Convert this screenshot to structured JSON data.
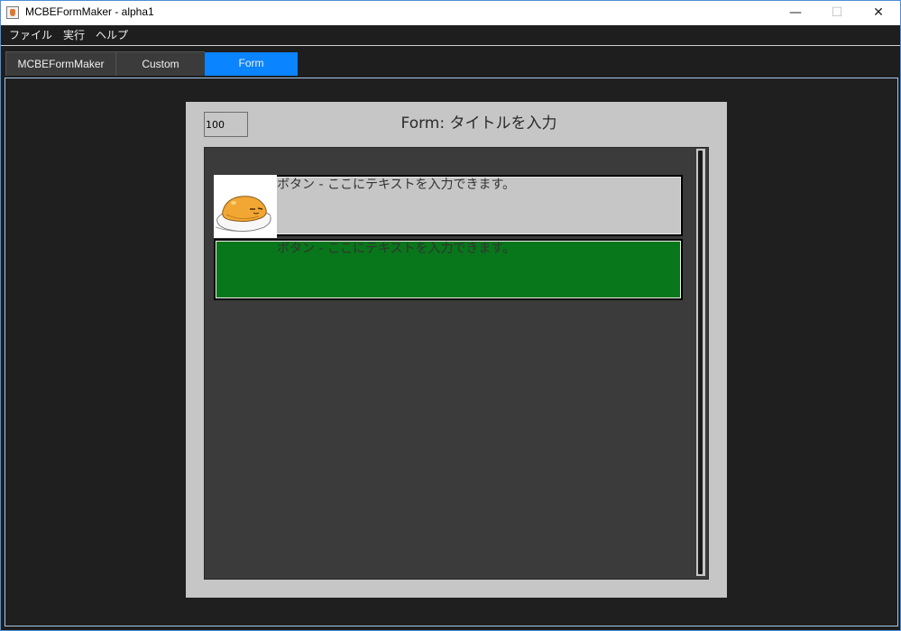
{
  "window": {
    "title": "MCBEFormMaker - alpha1",
    "controls": {
      "minimize": "—",
      "maximize": "☐",
      "close": "✕"
    }
  },
  "menu": [
    "ファイル",
    "実行",
    "ヘルプ"
  ],
  "tabs": [
    {
      "label": "MCBEFormMaker",
      "selected": false
    },
    {
      "label": "Custom",
      "selected": false
    },
    {
      "label": "Form",
      "selected": true
    }
  ],
  "form": {
    "size_value": "100",
    "title": "Form: タイトルを入力",
    "buttons": [
      {
        "text": "ボタン - ここにテキストを入力できます。",
        "has_image": true,
        "image": "sleeping-egg-yolk-character-icon",
        "color": "#c6c6c6"
      },
      {
        "text": "ボタン - ここにテキストを入力できます。",
        "has_image": false,
        "color": "#08761a"
      }
    ]
  },
  "colors": {
    "accent": "#0a84ff",
    "background": "#1e1e1e",
    "panel": "#c6c6c6",
    "form_body": "#3b3b3b"
  }
}
